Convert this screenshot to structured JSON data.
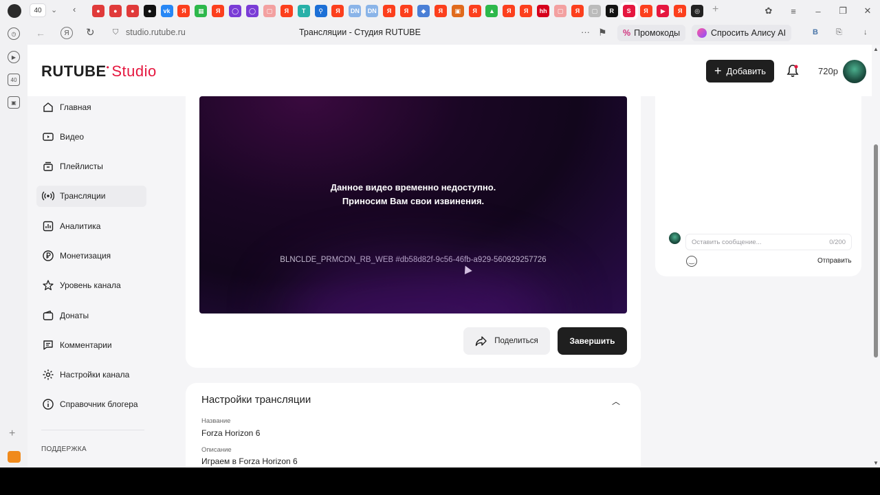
{
  "browser": {
    "tab_counter": "40",
    "url": "studio.rutube.ru",
    "page_title": "Трансляции - Студия RUTUBE",
    "promo_label": "Промокоды",
    "alice_label": "Спросить Алису AI",
    "strip_counter": "40"
  },
  "header": {
    "logo_main": "RUTUBE",
    "logo_studio": "Studio",
    "add_button": "Добавить",
    "balance": "720р"
  },
  "sidebar": {
    "items": [
      {
        "label": "Главная",
        "icon": "home-icon"
      },
      {
        "label": "Видео",
        "icon": "video-icon"
      },
      {
        "label": "Плейлисты",
        "icon": "playlist-icon"
      },
      {
        "label": "Трансляции",
        "icon": "broadcast-icon",
        "active": true
      },
      {
        "label": "Аналитика",
        "icon": "analytics-icon"
      },
      {
        "label": "Монетизация",
        "icon": "ruble-icon"
      },
      {
        "label": "Уровень канала",
        "icon": "star-icon"
      },
      {
        "label": "Донаты",
        "icon": "wallet-icon"
      },
      {
        "label": "Комментарии",
        "icon": "comment-icon"
      },
      {
        "label": "Настройки канала",
        "icon": "gear-icon"
      },
      {
        "label": "Справочник блогера",
        "icon": "info-icon"
      }
    ],
    "support_section": "ПОДДЕРЖКА"
  },
  "player": {
    "message_line1": "Данное видео временно недоступно.",
    "message_line2": "Приносим Вам свои извинения.",
    "error_code": "BLNCLDE_PRMCDN_RB_WEB #db58d82f-9c56-46fb-a929-560929257726",
    "share_button": "Поделиться",
    "finish_button": "Завершить"
  },
  "settings": {
    "title": "Настройки трансляции",
    "name_label": "Название",
    "name_value": "Forza Horizon 6",
    "description_label": "Описание",
    "description_value": "Играем в Forza Horizon 6"
  },
  "chat": {
    "placeholder": "Оставить сообщение...",
    "counter": "0/200",
    "send_button": "Отправить"
  },
  "colors": {
    "brand_red": "#e5173f",
    "dark": "#1f1f1f",
    "page_bg": "#f5f5f7"
  }
}
